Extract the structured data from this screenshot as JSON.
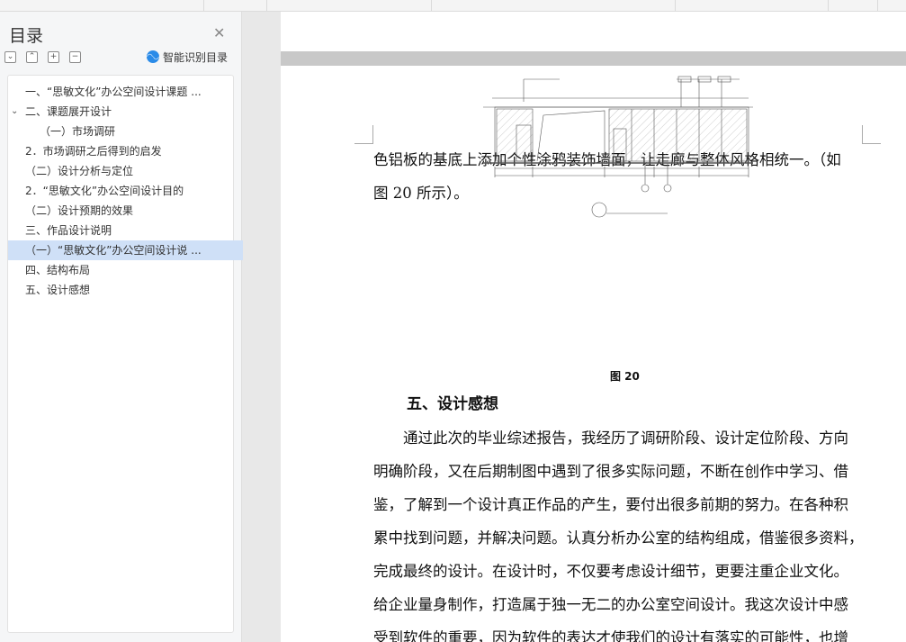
{
  "sidebar": {
    "title": "目录",
    "smart_toc_label": "智能识别目录",
    "toc": [
      {
        "label": "一、“思敏文化”办公空间设计课题 ..."
      },
      {
        "label": "二、课题展开设计"
      },
      {
        "label": "（一）市场调研"
      },
      {
        "label": "2．市场调研之后得到的启发"
      },
      {
        "label": "（二）设计分析与定位"
      },
      {
        "label": "2．“思敏文化”办公空间设计目的"
      },
      {
        "label": "（二）设计预期的效果"
      },
      {
        "label": "三、作品设计说明"
      },
      {
        "label": "（一）“思敏文化”办公空间设计说 ..."
      },
      {
        "label": "四、结构布局"
      },
      {
        "label": "五、设计感想"
      }
    ]
  },
  "document": {
    "para1_line1": "色铝板的基底上添加个性涂鸦装饰墙面，让走廊与整体风格相统一。（如",
    "para1_line2": "图 20 所示）。",
    "figure_caption": "图 20",
    "section_heading": "五、设计感想",
    "para2_lines": [
      "通过此次的毕业综述报告，我经历了调研阶段、设计定位阶段、方向",
      "明确阶段，又在后期制图中遇到了很多实际问题，不断在创作中学习、借",
      "鉴，了解到一个设计真正作品的产生，要付出很多前期的努力。在各种积",
      "累中找到问题，并解决问题。认真分析办公室的结构组成，借鉴很多资料，",
      "完成最终的设计。在设计时，不仅要考虑设计细节，更要注重企业文化。",
      "给企业量身制作，打造属于独一无二的办公室空间设计。我这次设计中感",
      "受到软件的重要，因为软件的表达才使我们的设计有落实的可能性，也增"
    ]
  },
  "colors": {
    "active_item": "#cfe0f7",
    "accent": "#2a8be8",
    "page_gap": "#c8c8c8"
  }
}
